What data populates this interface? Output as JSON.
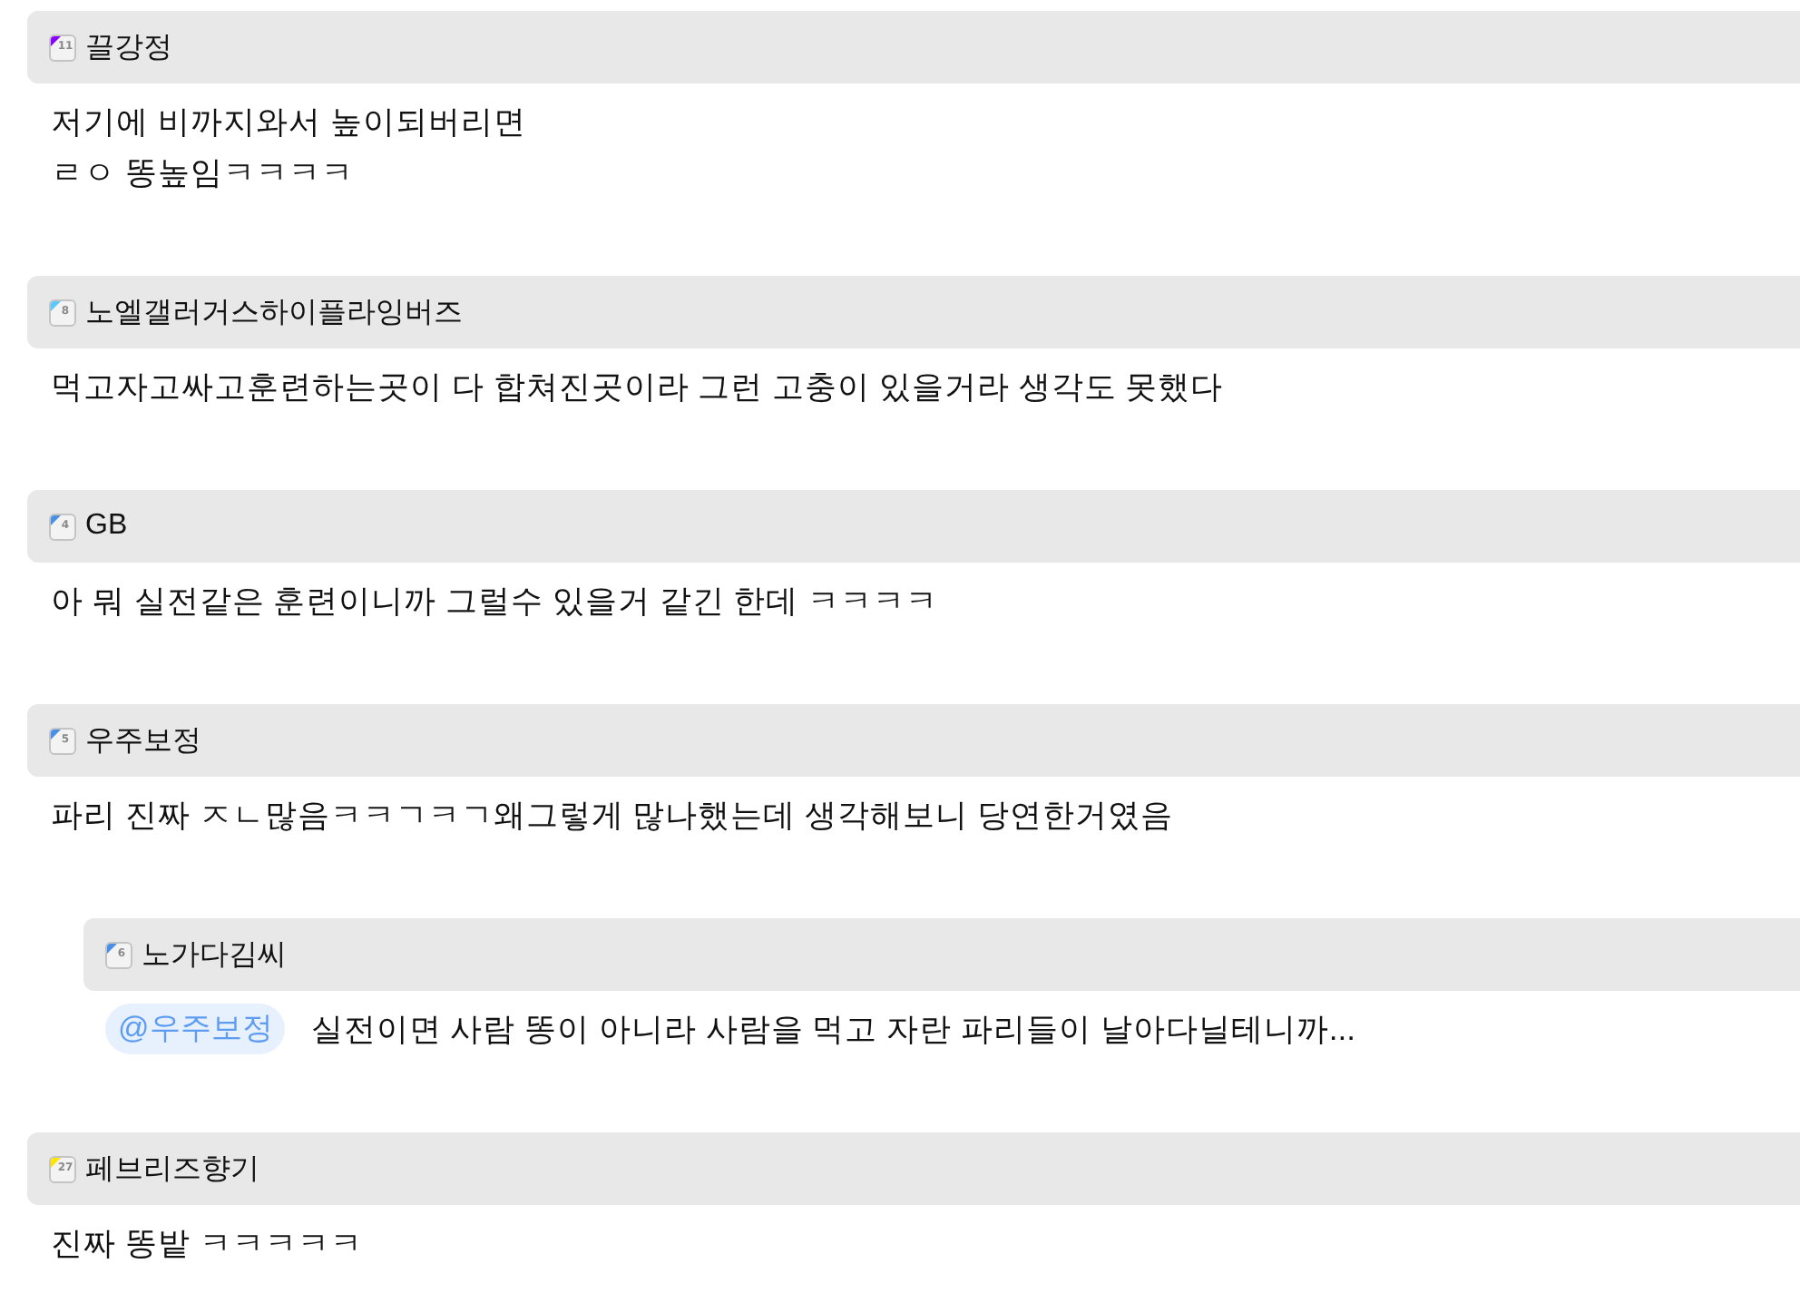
{
  "comments": [
    {
      "author": "끌강정",
      "badge": "11",
      "color": "#8a00ff",
      "text": "저기에 비까지와서 높이되버리면\nㄹㅇ 똥높임ㅋㅋㅋㅋ"
    },
    {
      "author": "노엘갤러거스하이플라잉버즈",
      "badge": "8",
      "color": "#5ac8fa",
      "text": "먹고자고싸고훈련하는곳이 다 합쳐진곳이라 그런 고충이 있을거라 생각도 못했다"
    },
    {
      "author": "GB",
      "badge": "4",
      "color": "#4a8fe6",
      "text": "아 뭐 실전같은 훈련이니까 그럴수 있을거 같긴 한데 ㅋㅋㅋㅋ"
    },
    {
      "author": "우주보정",
      "badge": "5",
      "color": "#4a8fe6",
      "text": "파리 진짜 ㅈㄴ많음ㅋㅋㄱㅋㄱ왜그렇게 많나했는데 생각해보니 당연한거였음",
      "replies": [
        {
          "author": "노가다김씨",
          "badge": "6",
          "color": "#4a8fe6",
          "mention": "@우주보정",
          "text": "실전이면 사람 똥이 아니라 사람을 먹고 자란 파리들이 날아다닐테니까..."
        }
      ]
    },
    {
      "author": "페브리즈향기",
      "badge": "27",
      "color": "#ffe600",
      "text": "진짜 똥밭 ㅋㅋㅋㅋㅋ"
    }
  ]
}
